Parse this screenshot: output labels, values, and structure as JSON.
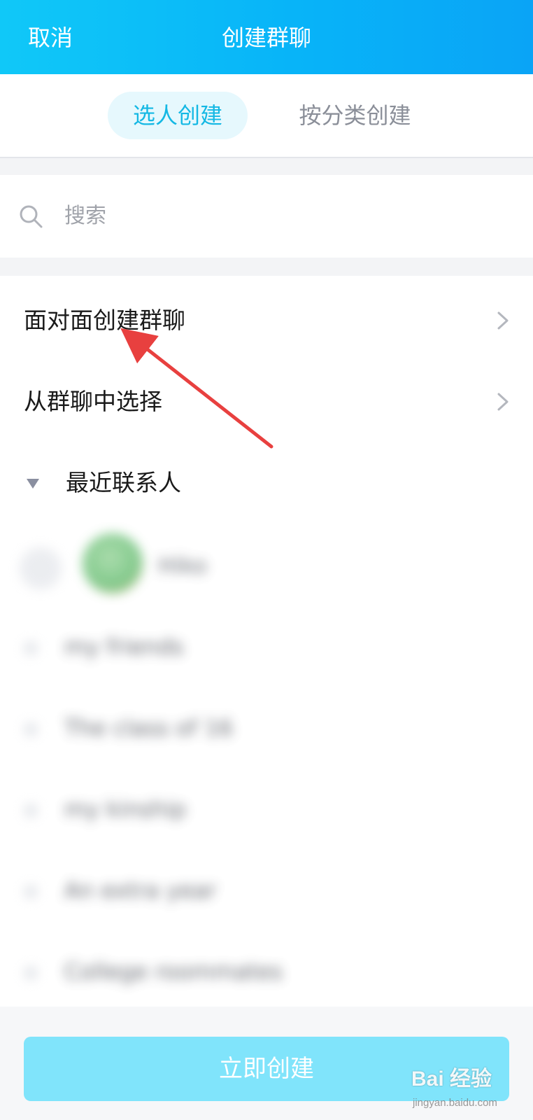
{
  "header": {
    "cancel_label": "取消",
    "title": "创建群聊"
  },
  "tabs": [
    {
      "label": "选人创建",
      "active": true
    },
    {
      "label": "按分类创建",
      "active": false
    }
  ],
  "search": {
    "placeholder": "搜索",
    "icon": "search-icon"
  },
  "menu_items": [
    {
      "label": "面对面创建群聊",
      "icon": "chevron-right-icon"
    },
    {
      "label": "从群聊中选择",
      "icon": "chevron-right-icon"
    }
  ],
  "recent_section": {
    "label": "最近联系人",
    "expanded": true,
    "icon": "triangle-down-icon"
  },
  "contacts": {
    "first_name": "Hiko",
    "groups": [
      "my friends",
      "The class of 16",
      "my kinship",
      "An extra year",
      "College roommates"
    ]
  },
  "footer": {
    "create_label": "立即创建"
  },
  "watermark": {
    "main_text": "Bai 经验",
    "sub_text": "jingyan.baidu.com"
  },
  "colors": {
    "header_gradient_start": "#10c8f8",
    "header_gradient_end": "#0aa4f6",
    "tab_active_text": "#14b8e4",
    "tab_active_bg": "#e6f8fd",
    "create_button_bg": "#80e4fb",
    "annotation_arrow": "#e8403f"
  }
}
